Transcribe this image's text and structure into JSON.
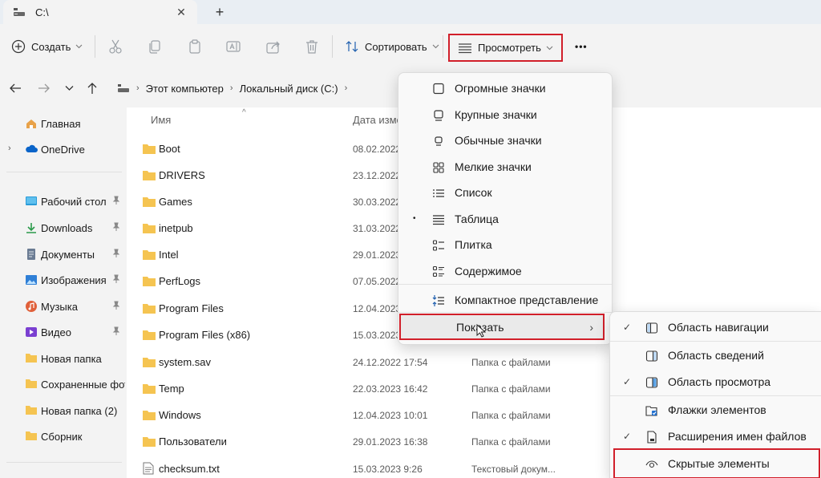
{
  "tab": {
    "title": "C:\\",
    "close": "✕",
    "new_tab": "+"
  },
  "toolbar": {
    "create_label": "Создать",
    "sort_label": "Сортировать",
    "view_label": "Просмотреть",
    "more_label": "•••",
    "chevron": "⌄"
  },
  "address": {
    "crumbs": [
      "Этот компьютер",
      "Локальный диск (C:)"
    ],
    "sep": "›"
  },
  "sidebar": {
    "items": [
      {
        "label": "Главная",
        "icon": "home-icon"
      },
      {
        "label": "OneDrive",
        "icon": "cloud-icon"
      },
      {
        "label": "Рабочий стол",
        "icon": "desktop-icon",
        "pinned": true
      },
      {
        "label": "Downloads",
        "icon": "download-icon",
        "pinned": true
      },
      {
        "label": "Документы",
        "icon": "document-icon",
        "pinned": true
      },
      {
        "label": "Изображения",
        "icon": "image-icon",
        "pinned": true
      },
      {
        "label": "Музыка",
        "icon": "music-icon",
        "pinned": true
      },
      {
        "label": "Видео",
        "icon": "video-icon",
        "pinned": true
      },
      {
        "label": "Новая папка",
        "icon": "folder-icon"
      },
      {
        "label": "Сохраненные фото",
        "icon": "folder-icon"
      },
      {
        "label": "Новая папка (2)",
        "icon": "folder-icon"
      },
      {
        "label": "Сборник",
        "icon": "folder-icon"
      }
    ],
    "expand_glyph": "›",
    "pin_glyph": "📌"
  },
  "list": {
    "columns": {
      "name": "Имя",
      "date": "Дата изме"
    },
    "sort_glyph": "^",
    "rows": [
      {
        "name": "Boot",
        "date": "08.02.2022",
        "type": ""
      },
      {
        "name": "DRIVERS",
        "date": "23.12.2022",
        "type": ""
      },
      {
        "name": "Games",
        "date": "30.03.2022",
        "type": ""
      },
      {
        "name": "inetpub",
        "date": "31.03.2022",
        "type": ""
      },
      {
        "name": "Intel",
        "date": "29.01.2023",
        "type": ""
      },
      {
        "name": "PerfLogs",
        "date": "07.05.2022",
        "type": ""
      },
      {
        "name": "Program Files",
        "date": "12.04.2023",
        "type": ""
      },
      {
        "name": "Program Files (x86)",
        "date": "15.03.2023",
        "type": ""
      },
      {
        "name": "system.sav",
        "date": "24.12.2022 17:54",
        "type": "Папка с файлами"
      },
      {
        "name": "Temp",
        "date": "22.03.2023 16:42",
        "type": "Папка с файлами"
      },
      {
        "name": "Windows",
        "date": "12.04.2023 10:01",
        "type": "Папка с файлами"
      },
      {
        "name": "Пользователи",
        "date": "29.01.2023 16:38",
        "type": "Папка с файлами"
      },
      {
        "name": "checksum.txt",
        "date": "15.03.2023 9:26",
        "type": "Текстовый докум..."
      }
    ]
  },
  "view_menu": {
    "items": [
      {
        "label": "Огромные значки",
        "icon": "extra-large-icons-icon"
      },
      {
        "label": "Крупные значки",
        "icon": "large-icons-icon"
      },
      {
        "label": "Обычные значки",
        "icon": "medium-icons-icon"
      },
      {
        "label": "Мелкие значки",
        "icon": "small-icons-icon"
      },
      {
        "label": "Список",
        "icon": "list-icon"
      },
      {
        "label": "Таблица",
        "icon": "details-icon",
        "selected": true
      },
      {
        "label": "Плитка",
        "icon": "tiles-icon"
      },
      {
        "label": "Содержимое",
        "icon": "content-icon"
      },
      {
        "label": "Компактное представление",
        "icon": "compact-icon"
      },
      {
        "label": "Показать",
        "icon": "",
        "submenu": true
      }
    ],
    "dot": "•",
    "arrow": "›"
  },
  "show_submenu": {
    "items": [
      {
        "label": "Область навигации",
        "checked": true,
        "icon": "navigation-pane-icon"
      },
      {
        "label": "Область сведений",
        "checked": false,
        "icon": "details-pane-icon"
      },
      {
        "label": "Область просмотра",
        "checked": true,
        "icon": "preview-pane-icon"
      },
      {
        "label": "Флажки элементов",
        "checked": false,
        "icon": "item-checkbox-icon"
      },
      {
        "label": "Расширения имен файлов",
        "checked": true,
        "icon": "file-extension-icon"
      },
      {
        "label": "Скрытые элементы",
        "checked": false,
        "icon": "eye-icon"
      }
    ],
    "check": "✓"
  },
  "colors": {
    "highlight": "#d11f2a",
    "folder": "#f5c451",
    "accent": "#0067c0"
  }
}
